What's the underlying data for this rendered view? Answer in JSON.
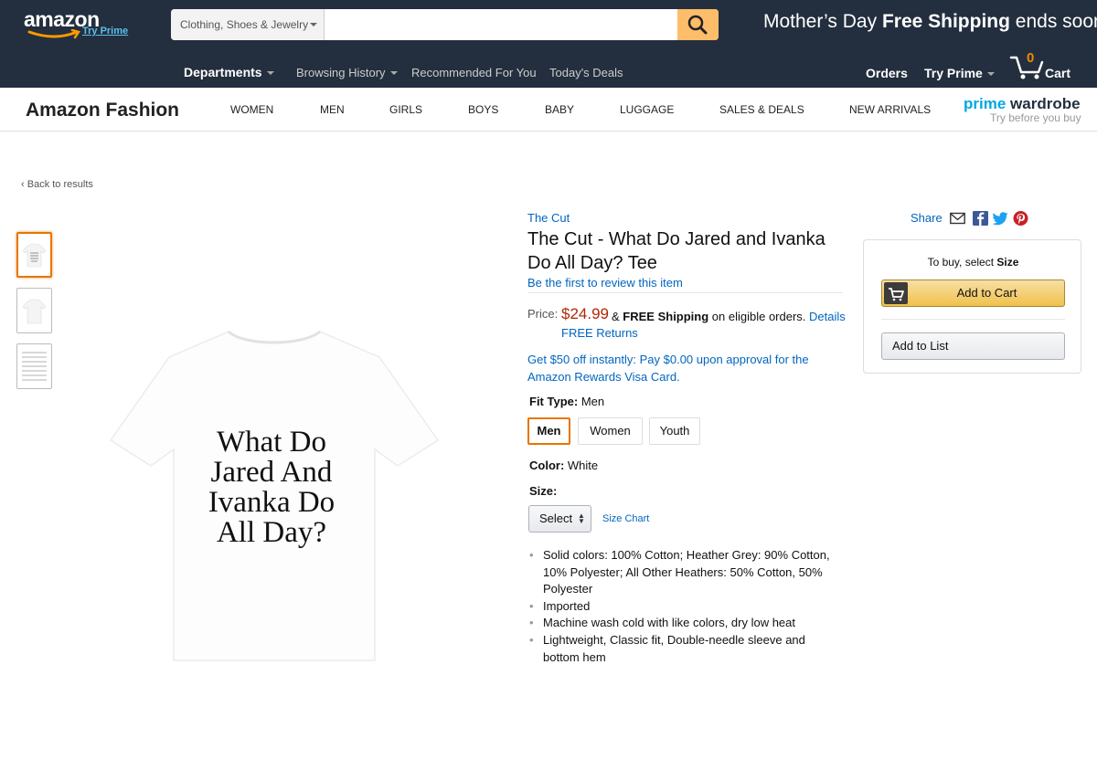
{
  "header": {
    "logo_text": "amazon",
    "logo_sub": "Try Prime",
    "search": {
      "department": "Clothing, Shoes & Jewelry",
      "placeholder": ""
    },
    "promo": {
      "prefix": "Mother’s Day ",
      "bold": "Free Shipping",
      "suffix": " ends soon"
    },
    "subnav": {
      "departments": "Departments",
      "browsing_history": "Browsing History",
      "recommended": "Recommended For You",
      "todays_deals": "Today's Deals",
      "orders": "Orders",
      "try_prime": "Try Prime",
      "cart": "Cart",
      "cart_count": "0"
    }
  },
  "fashion": {
    "title": "Amazon Fashion",
    "categories": [
      "WOMEN",
      "MEN",
      "GIRLS",
      "BOYS",
      "BABY",
      "LUGGAGE",
      "SALES & DEALS",
      "NEW ARRIVALS"
    ],
    "prime_wardrobe": {
      "prime": "prime",
      "wardrobe": " wardrobe",
      "tagline": "Try before you buy"
    }
  },
  "nav": {
    "back": "Back to results"
  },
  "product": {
    "brand": "The Cut",
    "title": "The Cut - What Do Jared and Ivanka Do All Day? Tee",
    "review_link": "Be the first to review this item",
    "price_label": "Price:",
    "price": "$24.99",
    "shipping_prefix": "& ",
    "shipping_bold": "FREE Shipping",
    "shipping_suffix": " on eligible orders. ",
    "details_link": "Details",
    "free_returns": "FREE Returns",
    "offer": "Get $50 off instantly: Pay $0.00 upon approval for the Amazon Rewards Visa Card.",
    "fit_type_label": "Fit Type:",
    "fit_type_value": " Men",
    "fit_options": [
      "Men",
      "Women",
      "Youth"
    ],
    "color_label": "Color:",
    "color_value": " White",
    "size_label": "Size:",
    "size_select": "Select",
    "size_chart": "Size Chart",
    "bullets": [
      "Solid colors: 100% Cotton; Heather Grey: 90% Cotton, 10% Polyester; All Other Heathers: 50% Cotton, 50% Polyester",
      "Imported",
      "Machine wash cold with like colors, dry low heat",
      "Lightweight, Classic fit, Double-needle sleeve and bottom hem"
    ],
    "shirt_text": [
      "What Do",
      "Jared And",
      "Ivanka Do",
      "All Day?"
    ]
  },
  "buybox": {
    "select_prefix": "To buy, select ",
    "select_bold": "Size",
    "add_to_cart": "Add to Cart",
    "add_to_list": "Add to List"
  },
  "share": {
    "label": "Share",
    "icons": [
      "email-icon",
      "facebook-icon",
      "twitter-icon",
      "pinterest-icon"
    ]
  },
  "colors": {
    "nav_bg": "#232f3e",
    "accent": "#febd69",
    "price": "#b12704",
    "link": "#0066c0",
    "selected": "#e77600"
  }
}
